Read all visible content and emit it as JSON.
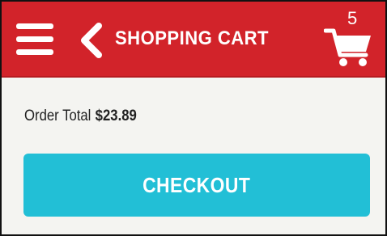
{
  "header": {
    "title": "SHOPPING CART",
    "cart_count": "5",
    "menu_icon": "hamburger-menu-icon",
    "back_icon": "chevron-left-icon",
    "cart_icon": "shopping-cart-icon"
  },
  "order": {
    "total_label": "Order Total",
    "total_value": "$23.89"
  },
  "checkout": {
    "label": "CHECKOUT"
  },
  "colors": {
    "header_bg": "#d2232a",
    "content_bg": "#f4f4f1",
    "checkout_bg": "#22bfd6",
    "text_dark": "#222222"
  }
}
